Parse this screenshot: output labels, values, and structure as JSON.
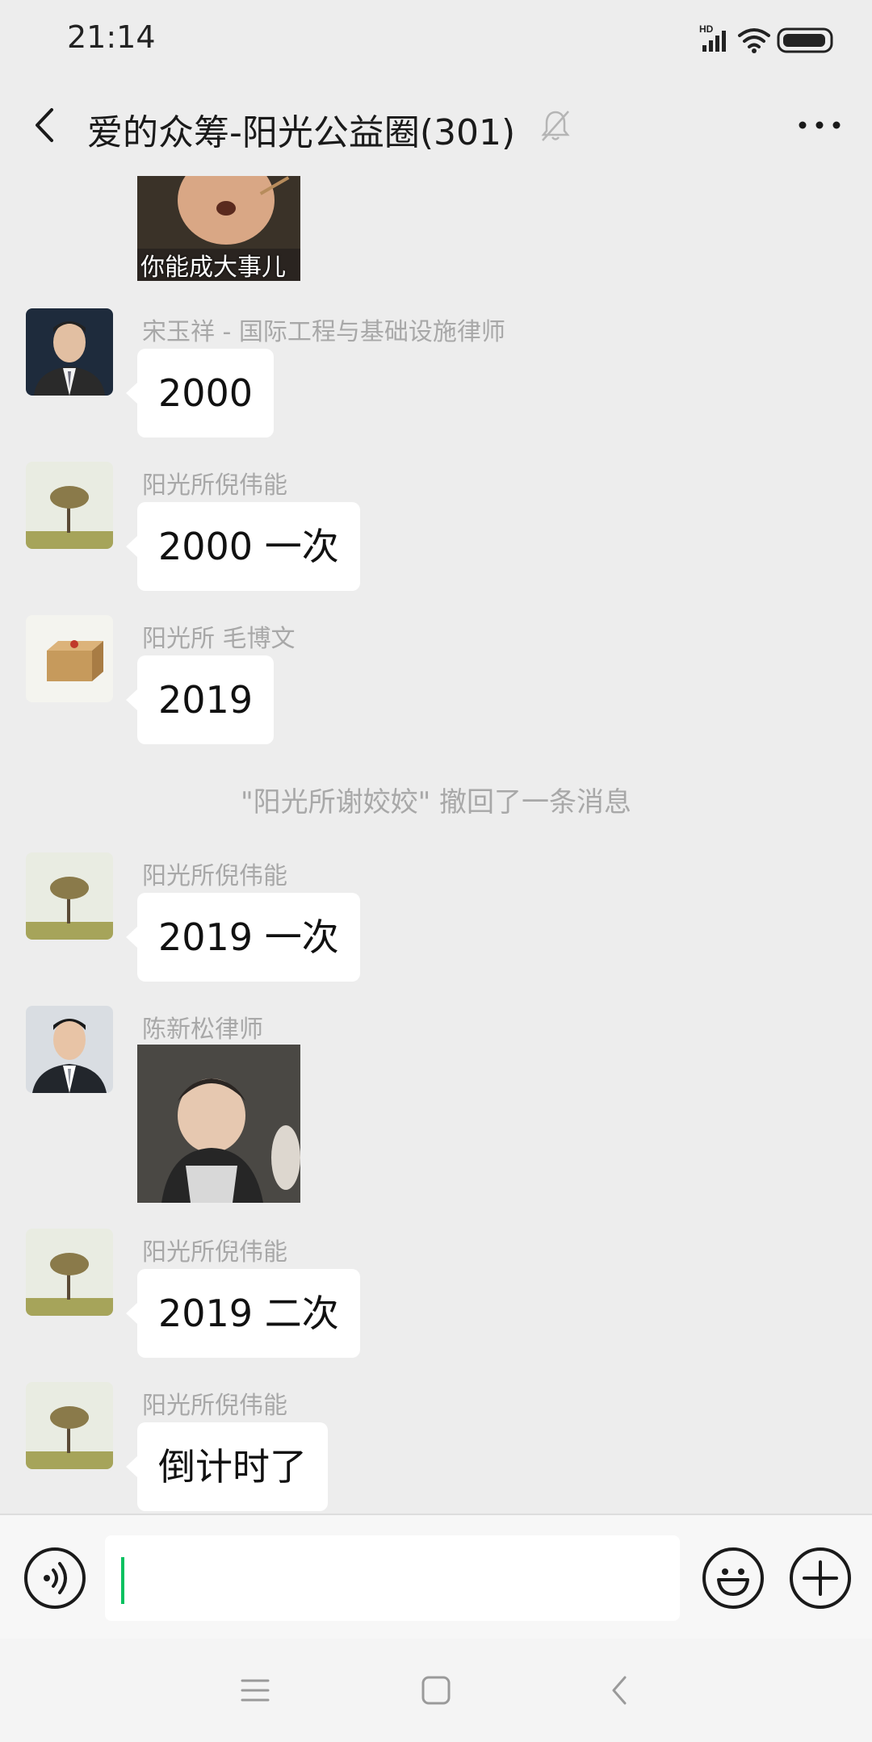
{
  "status_bar": {
    "time": "21:14",
    "network_label": "HD"
  },
  "header": {
    "title": "爱的众筹-阳光公益圈(301)"
  },
  "messages": {
    "m1": {
      "sticker_caption": "你能成大事儿"
    },
    "m2": {
      "sender": "宋玉祥 - 国际工程与基础设施律师",
      "text": "2000"
    },
    "m3": {
      "sender": "阳光所倪伟能",
      "text": "2000 一次"
    },
    "m4": {
      "sender": "阳光所 毛博文",
      "text": "2019"
    },
    "recall": "\"阳光所谢姣姣\" 撤回了一条消息",
    "m5": {
      "sender": "阳光所倪伟能",
      "text": "2019 一次"
    },
    "m6": {
      "sender": "陈新松律师"
    },
    "m7": {
      "sender": "阳光所倪伟能",
      "text": "2019 二次"
    },
    "m8": {
      "sender": "阳光所倪伟能",
      "text": "倒计时了"
    }
  },
  "input": {
    "value": ""
  },
  "colors": {
    "background": "#ededed",
    "bubble": "#ffffff",
    "accent": "#07c160"
  },
  "icons": [
    "back-arrow-icon",
    "mute-bell-icon",
    "more-icon",
    "voice-icon",
    "emoji-icon",
    "plus-icon",
    "menu-icon",
    "home-icon",
    "nav-back-icon"
  ]
}
